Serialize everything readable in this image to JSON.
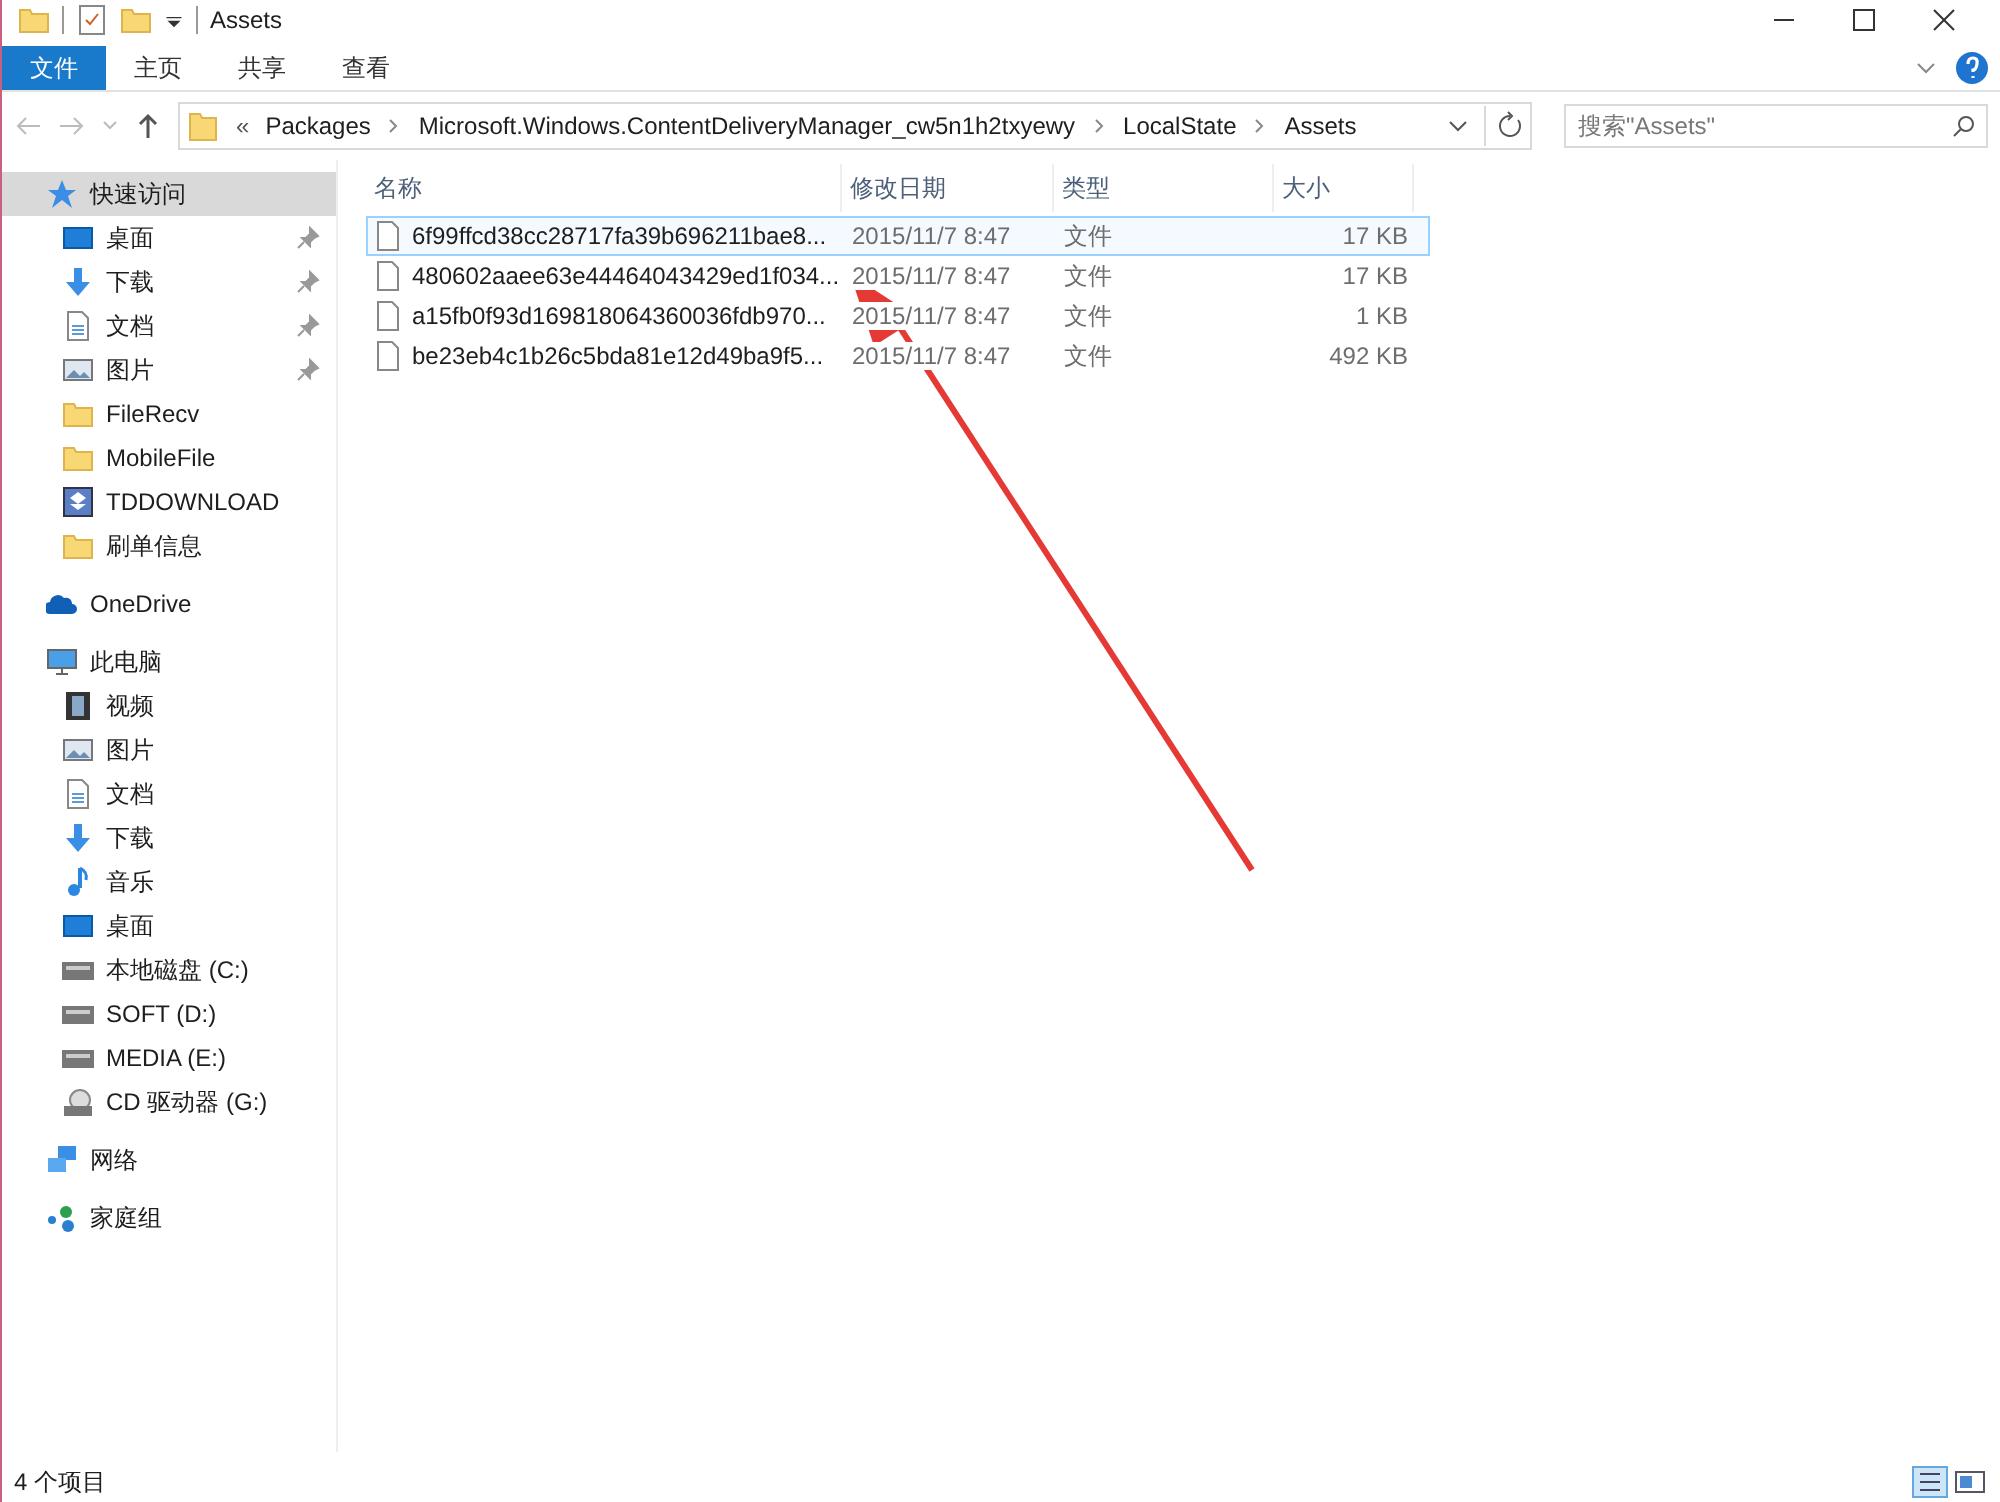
{
  "window": {
    "title": "Assets"
  },
  "ribbon": {
    "tabs": [
      {
        "label": "文件",
        "selected": true
      },
      {
        "label": "主页",
        "selected": false
      },
      {
        "label": "共享",
        "selected": false
      },
      {
        "label": "查看",
        "selected": false
      }
    ]
  },
  "address_bar": {
    "overflow": "«",
    "crumbs": [
      "Packages",
      "Microsoft.Windows.ContentDeliveryManager_cw5n1h2txyewy",
      "LocalState",
      "Assets"
    ]
  },
  "search": {
    "placeholder": "搜索\"Assets\""
  },
  "sidebar": {
    "items": [
      {
        "label": "快速访问",
        "kind": "star",
        "selected": true,
        "children": [
          {
            "label": "桌面",
            "kind": "desktop",
            "pinned": true
          },
          {
            "label": "下载",
            "kind": "download",
            "pinned": true
          },
          {
            "label": "文档",
            "kind": "doc",
            "pinned": true
          },
          {
            "label": "图片",
            "kind": "picture",
            "pinned": true
          },
          {
            "label": "FileRecv",
            "kind": "folder",
            "pinned": false
          },
          {
            "label": "MobileFile",
            "kind": "folder",
            "pinned": false
          },
          {
            "label": "TDDOWNLOAD",
            "kind": "box",
            "pinned": false
          },
          {
            "label": "刷单信息",
            "kind": "folder",
            "pinned": false
          }
        ]
      },
      {
        "label": "OneDrive",
        "kind": "cloud",
        "selected": false
      },
      {
        "label": "此电脑",
        "kind": "pc",
        "selected": false,
        "children": [
          {
            "label": "视频",
            "kind": "video"
          },
          {
            "label": "图片",
            "kind": "picture"
          },
          {
            "label": "文档",
            "kind": "doc"
          },
          {
            "label": "下载",
            "kind": "download"
          },
          {
            "label": "音乐",
            "kind": "music"
          },
          {
            "label": "桌面",
            "kind": "desktop"
          },
          {
            "label": "本地磁盘 (C:)",
            "kind": "drive"
          },
          {
            "label": "SOFT (D:)",
            "kind": "drive"
          },
          {
            "label": "MEDIA (E:)",
            "kind": "drive"
          },
          {
            "label": "CD 驱动器 (G:)",
            "kind": "cd"
          }
        ]
      },
      {
        "label": "网络",
        "kind": "network",
        "selected": false
      },
      {
        "label": "家庭组",
        "kind": "homegroup",
        "selected": false
      }
    ]
  },
  "table": {
    "columns": [
      "名称",
      "修改日期",
      "类型",
      "大小"
    ],
    "rows": [
      {
        "name": "6f99ffcd38cc28717fa39b696211bae8...",
        "date": "2015/11/7 8:47",
        "type": "文件",
        "size": "17 KB",
        "selected": true
      },
      {
        "name": "480602aaee63e44464043429ed1f034...",
        "date": "2015/11/7 8:47",
        "type": "文件",
        "size": "17 KB",
        "selected": false
      },
      {
        "name": "a15fb0f93d169818064360036fdb970...",
        "date": "2015/11/7 8:47",
        "type": "文件",
        "size": "1 KB",
        "selected": false
      },
      {
        "name": "be23eb4c1b26c5bda81e12d49ba9f5...",
        "date": "2015/11/7 8:47",
        "type": "文件",
        "size": "492 KB",
        "selected": false
      }
    ]
  },
  "status_bar": {
    "count": "4 个项目"
  }
}
